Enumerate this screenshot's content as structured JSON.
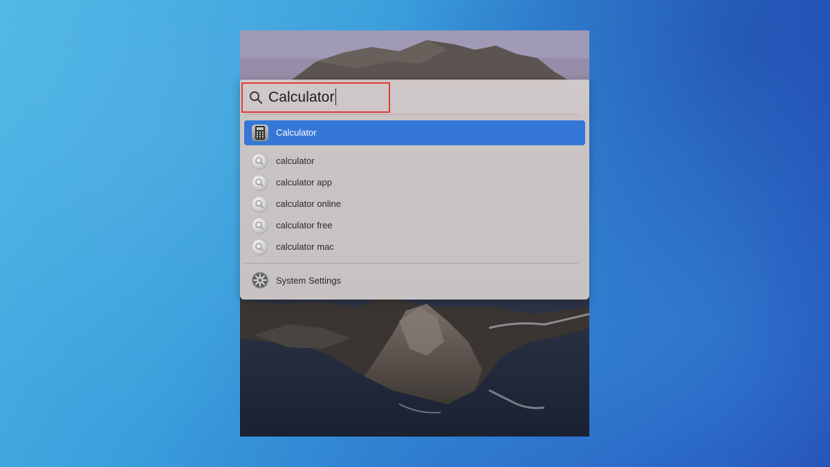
{
  "spotlight": {
    "query": "Calculator",
    "top_hit": {
      "label": "Calculator",
      "icon": "calculator-app-icon"
    },
    "suggestions": [
      {
        "label": "calculator",
        "icon": "search-suggestion-icon"
      },
      {
        "label": "calculator app",
        "icon": "search-suggestion-icon"
      },
      {
        "label": "calculator online",
        "icon": "search-suggestion-icon"
      },
      {
        "label": "calculator free",
        "icon": "search-suggestion-icon"
      },
      {
        "label": "calculator mac",
        "icon": "search-suggestion-icon"
      }
    ],
    "other_result": {
      "label": "System Settings",
      "icon": "system-settings-gear-icon"
    }
  },
  "colors": {
    "selection": "#3577d6",
    "highlight_box": "#e33b34",
    "background_gradient_start": "#4fb7e6",
    "background_gradient_end": "#2144b0"
  }
}
